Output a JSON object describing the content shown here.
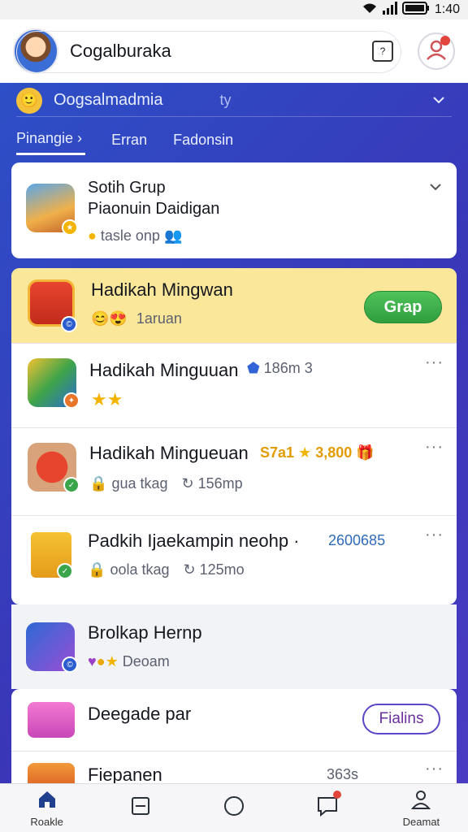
{
  "status_bar": {
    "time": "1:40",
    "icons": [
      "wifi-icon",
      "signal-icon",
      "battery-icon"
    ]
  },
  "app_bar": {
    "user_name": "Cogalburaka"
  },
  "account": {
    "name": "Oogsalmadmia",
    "suffix": "ty",
    "emoji": "🙂"
  },
  "tabs": [
    {
      "label": "Pinangie ›"
    },
    {
      "label": "Erran"
    },
    {
      "label": "Fadonsin"
    }
  ],
  "group_card": {
    "title_line1": "Sotih Grup",
    "title_line2": "Piaonuin Daidigan",
    "meta": "tasle onp"
  },
  "list": [
    {
      "title": "Hadikah Mingwan",
      "meta": "1aruan",
      "button": "Grap"
    },
    {
      "title": "Hadikah Minguuan",
      "extra": "186m 3",
      "stars": "★★"
    },
    {
      "title": "Hadikah Mingueuan",
      "tag": "S7a1",
      "coins": "3,800",
      "meta1": "gua tkag",
      "meta2": "156mp"
    },
    {
      "title": "Padkih Ijaekampin neohp ·",
      "number": "2600685",
      "meta1": "oola tkag",
      "meta2": "125mo"
    }
  ],
  "plain_item": {
    "title": "Brolkap Hernp",
    "meta": "Deoam"
  },
  "bottom_items": [
    {
      "title": "Deegade par",
      "button": "Fialins"
    },
    {
      "title": "Fiepanen",
      "meta": "363s"
    }
  ],
  "more_glyph": "···",
  "bottom_nav": [
    {
      "label": "Roakle",
      "icon": "home-icon"
    },
    {
      "label": "",
      "icon": "square-icon"
    },
    {
      "label": "",
      "icon": "circle-icon"
    },
    {
      "label": "",
      "icon": "chat-icon"
    },
    {
      "label": "Deamat",
      "icon": "person-icon"
    }
  ]
}
